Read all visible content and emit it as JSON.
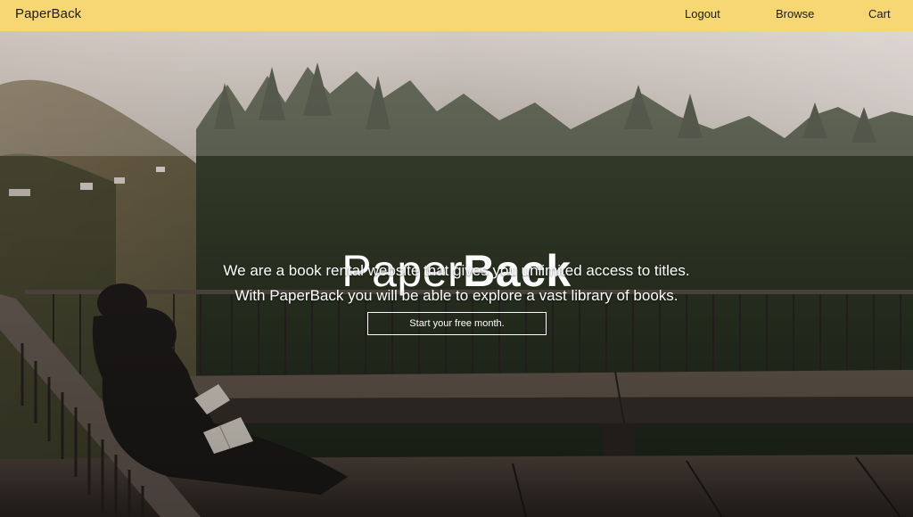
{
  "navbar": {
    "brand": "PaperBack",
    "links": {
      "logout": "Logout",
      "browse": "Browse",
      "cart": "Cart"
    }
  },
  "hero": {
    "title_light": "Paper",
    "title_bold": "Back",
    "line1": "We are a book rental website that gives you unlimited access to titles.",
    "line2": "With PaperBack you will be able to explore a vast library of books.",
    "cta_label": "Start your free month."
  },
  "colors": {
    "navbar_bg": "#f7d774",
    "text_light": "#ffffff",
    "text_dark": "#1b1b1b"
  }
}
